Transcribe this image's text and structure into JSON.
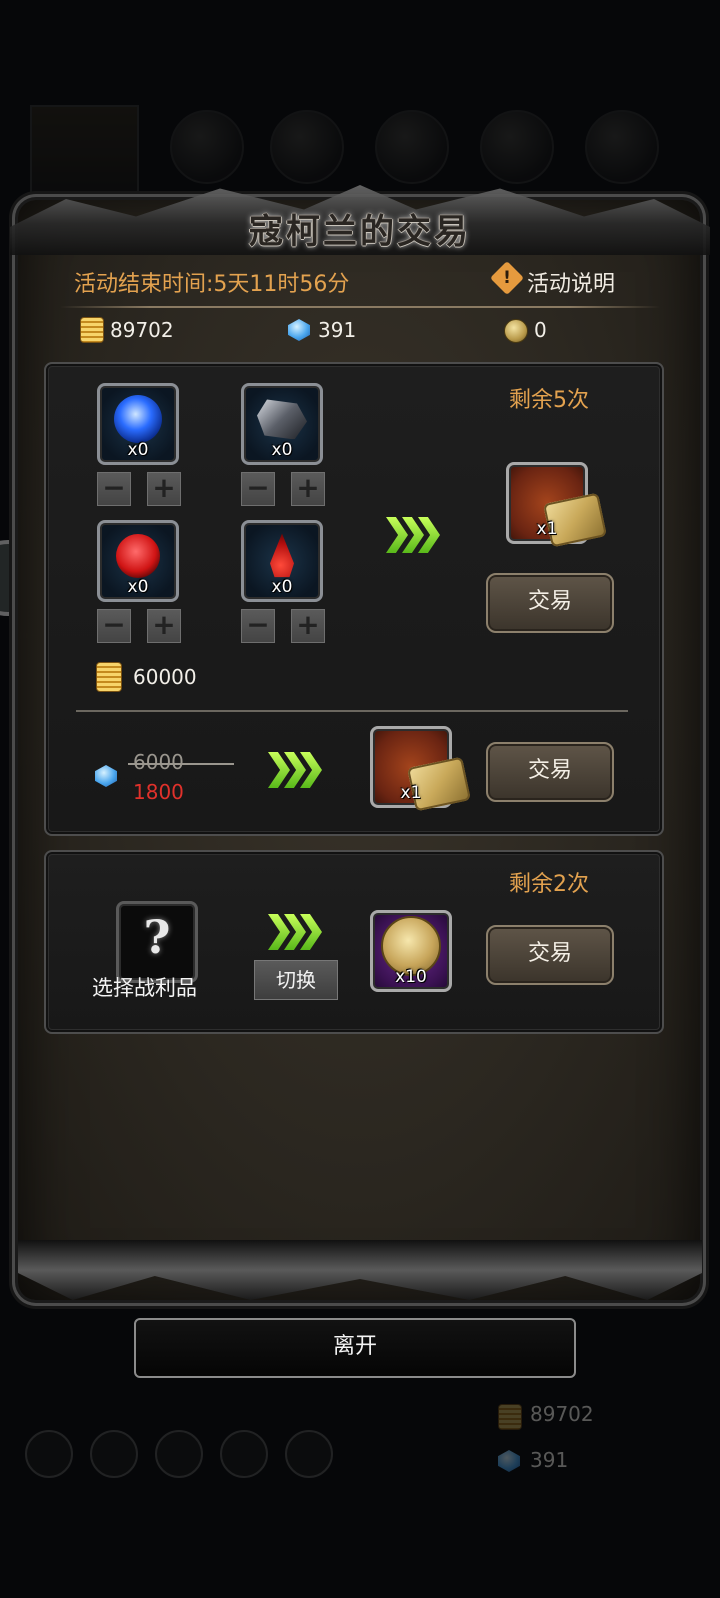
{
  "dialog": {
    "title": "寇柯兰的交易",
    "end_time": "活动结束时间:5天11时56分",
    "help_label": "活动说明"
  },
  "resources": {
    "gold": "89702",
    "gem": "391",
    "medal": "0"
  },
  "trade1": {
    "remaining": "剩余5次",
    "materials": [
      {
        "name": "blue-orb",
        "qty": "x0"
      },
      {
        "name": "dark-ore",
        "qty": "x0"
      },
      {
        "name": "red-flower",
        "qty": "x0"
      },
      {
        "name": "blood-drop",
        "qty": "x0"
      }
    ],
    "gold_cost": "60000",
    "reward_qty": "x1",
    "trade_label": "交易"
  },
  "trade1b": {
    "old_price": "6000",
    "new_price": "1800",
    "reward_qty": "x1",
    "trade_label": "交易"
  },
  "trade2": {
    "remaining": "剩余2次",
    "select_label": "选择战利品",
    "switch_label": "切换",
    "reward_qty": "x10",
    "trade_label": "交易"
  },
  "footer": {
    "leave_label": "离开"
  },
  "background": {
    "gold": "89702",
    "gem": "391"
  }
}
